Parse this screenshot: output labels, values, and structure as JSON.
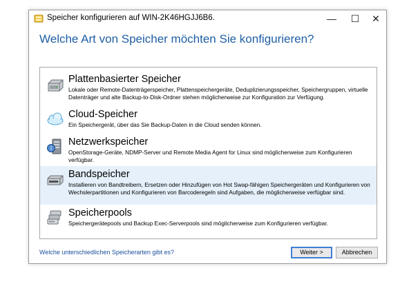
{
  "window": {
    "title": "Speicher konfigurieren auf WIN-2K46HGJJ6B6.",
    "minimize_glyph": "—",
    "maximize_glyph": "☐",
    "close_glyph": "✕"
  },
  "heading": "Welche Art von Speicher möchten Sie konfigurieren?",
  "storage_types": [
    {
      "title": "Plattenbasierter Speicher",
      "description": "Lokale oder Remote-Datenträgerspeicher, Plattenspeichergeräte, Deduplizierungsspeicher, Speichergruppen, virtuelle Datenträger und alte Backup-to-Disk-Ordner stehen möglicherweise zur Konfiguration zur Verfügung.",
      "icon": "hard-disk-icon"
    },
    {
      "title": "Cloud-Speicher",
      "description": "Ein Speichergerät, über das Sie Backup-Daten in die Cloud senden können.",
      "icon": "cloud-icon"
    },
    {
      "title": "Netzwerkspeicher",
      "description": "OpenStorage-Geräte, NDMP-Server und Remote Media Agent for Linux sind möglicherweise zum Konfigurieren verfügbar.",
      "icon": "network-server-icon"
    },
    {
      "title": "Bandspeicher",
      "description": "Installieren von Bandtreibern, Ersetzen oder Hinzufügen von Hot Swap-fähigen Speichergeräten und Konfigurieren von Wechslerpartitionen und Konfigurieren von Barcoderegeln sind Aufgaben, die möglicherweise verfügbar sind.",
      "icon": "tape-drive-icon",
      "selected": true
    },
    {
      "title": "Speicherpools",
      "description": "Speichergerätepools und Backup Exec-Serverpools sind möglicherweise zum Konfigurieren verfügbar.",
      "icon": "storage-pool-icon"
    }
  ],
  "footer": {
    "help_link": "Welche unterschiedlichen Speicherarten gibt es?",
    "next_label": "Weiter >",
    "cancel_label": "Abbrechen"
  }
}
